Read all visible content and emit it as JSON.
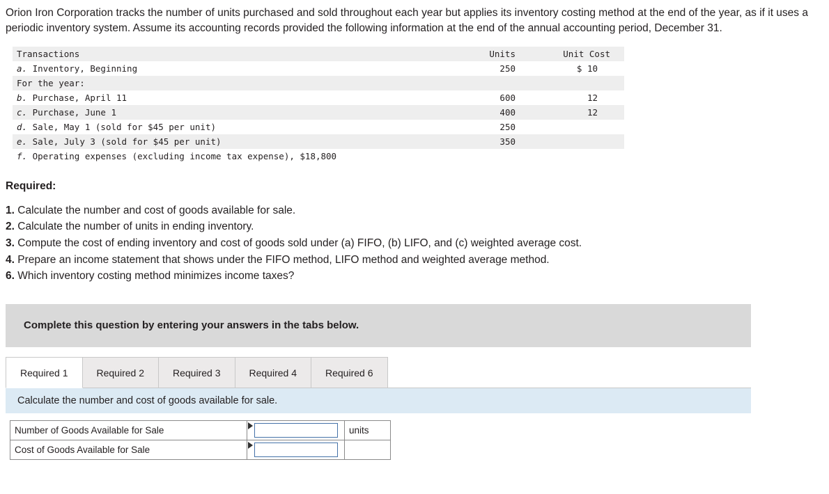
{
  "intro": "Orion Iron Corporation tracks the number of units purchased and sold throughout each year but applies its inventory costing method at the end of the year, as if it uses a periodic inventory system. Assume its accounting records provided the following information at the end of the annual accounting period, December 31.",
  "transactions_table": {
    "headers": {
      "transactions": "Transactions",
      "units": "Units",
      "unit_cost": "Unit Cost"
    },
    "rows": [
      {
        "label_italic": "a.",
        "label": "Inventory, Beginning",
        "units": "250",
        "unit_cost": "$ 10",
        "shade": true
      },
      {
        "label_italic": "",
        "label": "For the year:",
        "units": "",
        "unit_cost": "",
        "shade": false
      },
      {
        "label_italic": "b.",
        "label": "Purchase, April 11",
        "units": "600",
        "unit_cost": "12",
        "shade": true
      },
      {
        "label_italic": "c.",
        "label": "Purchase, June 1",
        "units": "400",
        "unit_cost": "12",
        "shade": false
      },
      {
        "label_italic": "d.",
        "label": "Sale, May 1 (sold for $45 per unit)",
        "units": "250",
        "unit_cost": "",
        "shade": true
      },
      {
        "label_italic": "e.",
        "label": "Sale, July 3 (sold for $45 per unit)",
        "units": "350",
        "unit_cost": "",
        "shade": false
      },
      {
        "label_italic": "f.",
        "label": "Operating expenses (excluding income tax expense), $18,800",
        "units": "",
        "unit_cost": "",
        "shade": false
      }
    ]
  },
  "required": {
    "heading": "Required:",
    "items": [
      {
        "num": "1.",
        "text": "Calculate the number and cost of goods available for sale."
      },
      {
        "num": "2.",
        "text": "Calculate the number of units in ending inventory."
      },
      {
        "num": "3.",
        "text": "Compute the cost of ending inventory and cost of goods sold under (a) FIFO, (b) LIFO, and (c) weighted average cost."
      },
      {
        "num": "4.",
        "text": "Prepare an income statement that shows under the FIFO method, LIFO method and weighted average method."
      },
      {
        "num": "6.",
        "text": "Which inventory costing method minimizes income taxes?"
      }
    ]
  },
  "instruction_bar": "Complete this question by entering your answers in the tabs below.",
  "tabs": [
    {
      "label": "Required 1",
      "active": true
    },
    {
      "label": "Required 2",
      "active": false
    },
    {
      "label": "Required 3",
      "active": false
    },
    {
      "label": "Required 4",
      "active": false
    },
    {
      "label": "Required 6",
      "active": false
    }
  ],
  "prompt": "Calculate the number and cost of goods available for sale.",
  "answer_table": {
    "rows": [
      {
        "label": "Number of Goods Available for Sale",
        "value": "",
        "unit": "units"
      },
      {
        "label": "Cost of Goods Available for Sale",
        "value": "",
        "unit": ""
      }
    ]
  }
}
